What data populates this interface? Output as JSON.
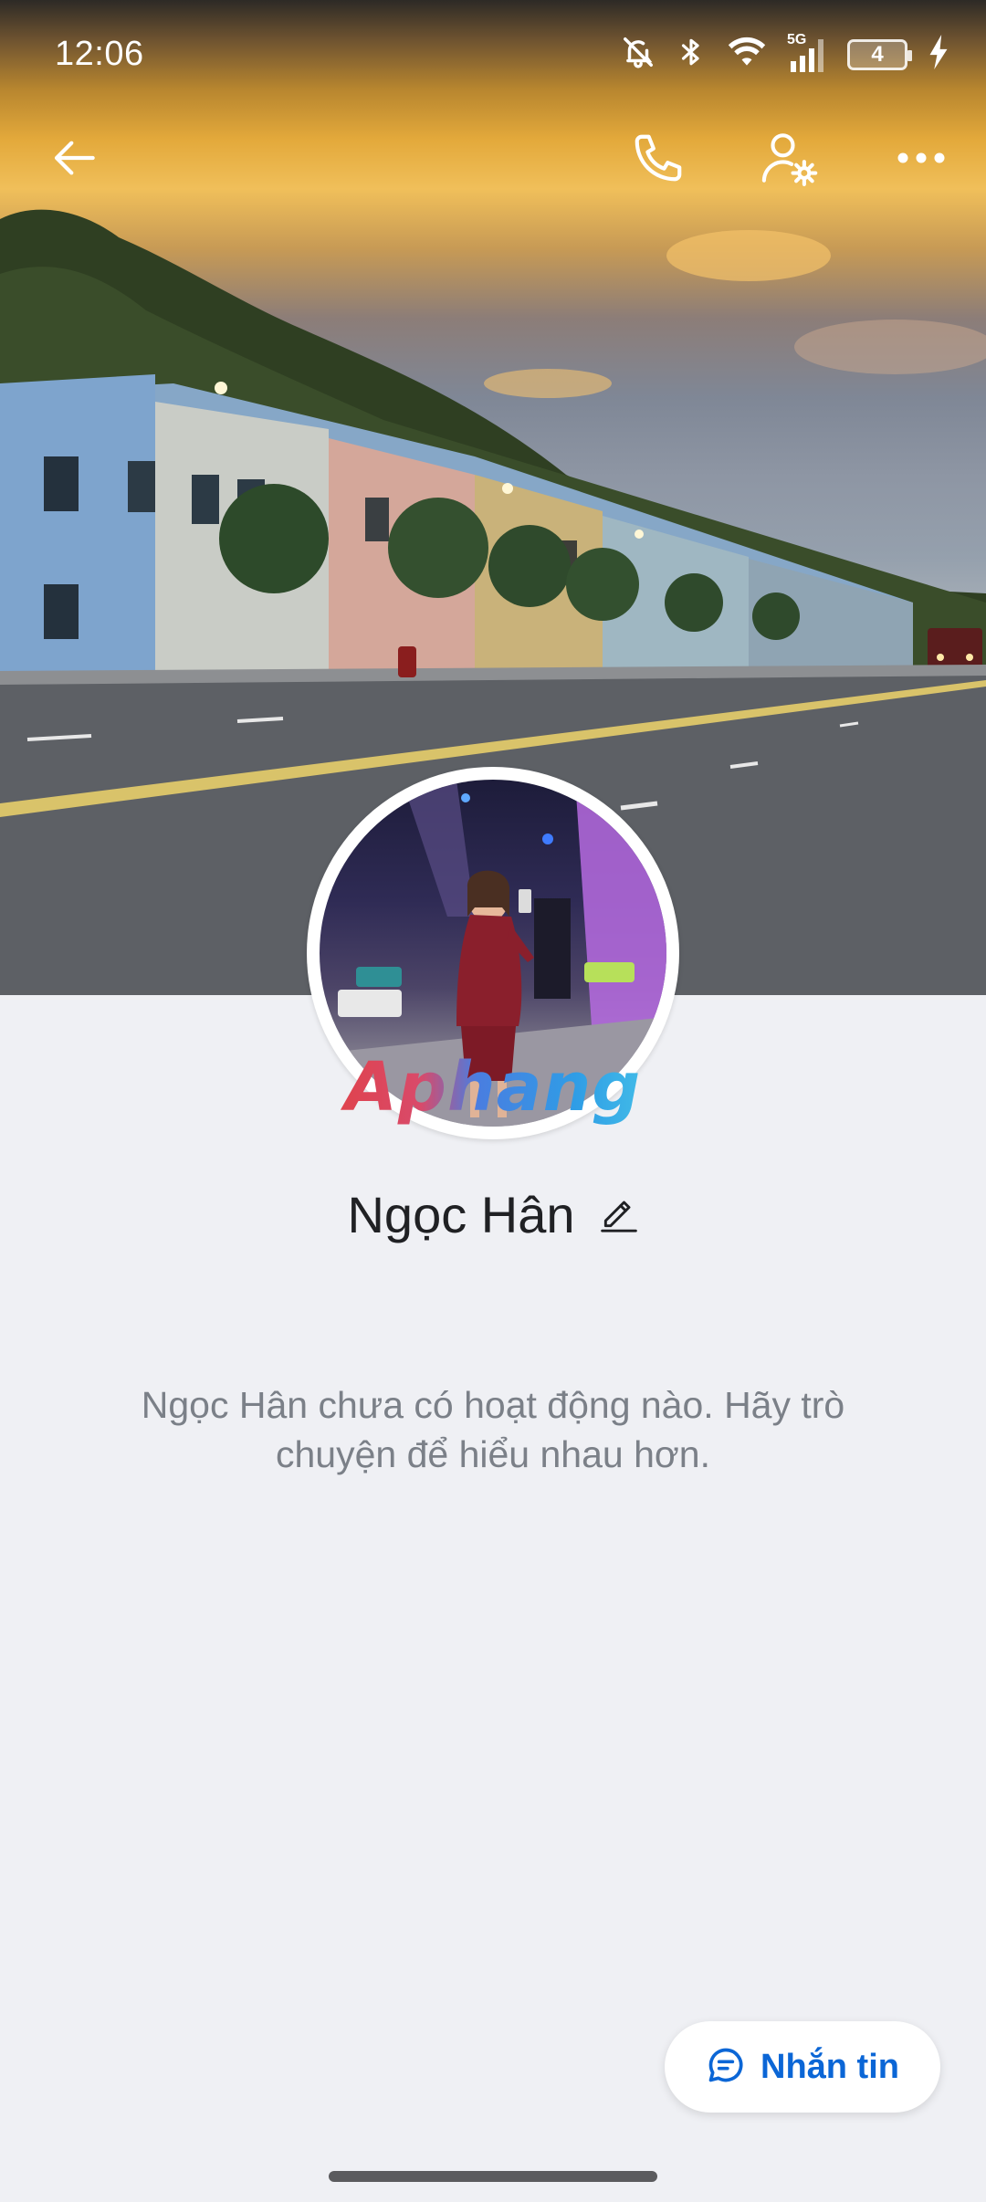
{
  "status_bar": {
    "time": "12:06",
    "network": "5G",
    "battery_level": "4",
    "icons": [
      "mute-icon",
      "bluetooth-icon",
      "wifi-icon",
      "signal-icon",
      "battery-icon",
      "charging-icon"
    ]
  },
  "top_bar": {
    "icons": [
      "back-arrow-icon",
      "phone-icon",
      "profile-settings-icon",
      "more-options-icon"
    ]
  },
  "profile": {
    "name": "Ngọc Hân",
    "avatar_watermark": "Aphang",
    "empty_message": "Ngọc Hân chưa có hoạt động nào. Hãy trò chuyện để hiểu nhau hơn."
  },
  "actions": {
    "message_label": "Nhắn tin"
  },
  "colors": {
    "accent": "#0b66d6",
    "page_background": "#eff0f4",
    "name_text": "#202124",
    "muted_text": "#7b8088"
  }
}
